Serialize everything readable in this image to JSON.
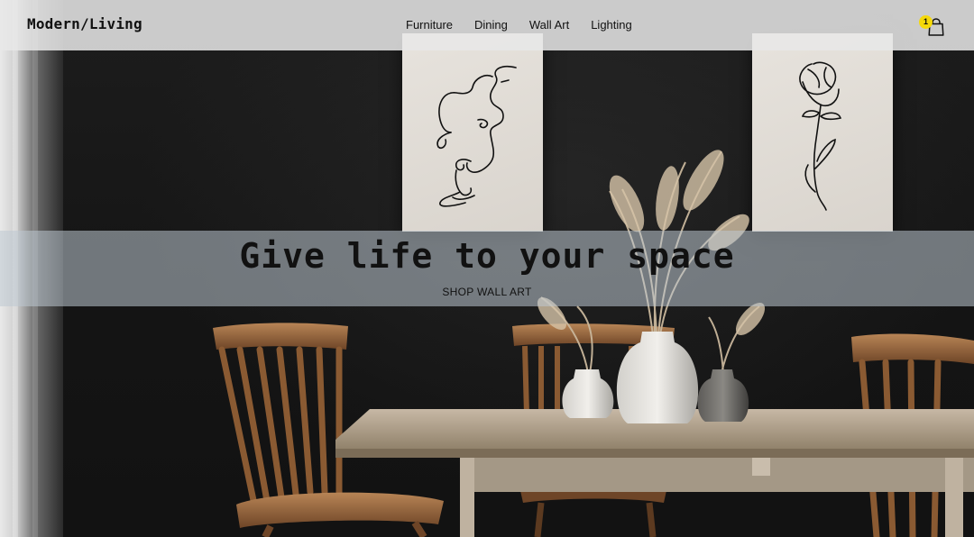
{
  "brand": {
    "logo": "Modern/Living"
  },
  "nav": {
    "items": [
      {
        "label": "Furniture"
      },
      {
        "label": "Dining"
      },
      {
        "label": "Wall Art"
      },
      {
        "label": "Lighting"
      }
    ]
  },
  "cart": {
    "count": "1",
    "icon": "shopping-bag-icon",
    "badge_color": "#f5d90a"
  },
  "hero": {
    "headline": "Give life to your space",
    "cta_label": "SHOP WALL ART"
  }
}
